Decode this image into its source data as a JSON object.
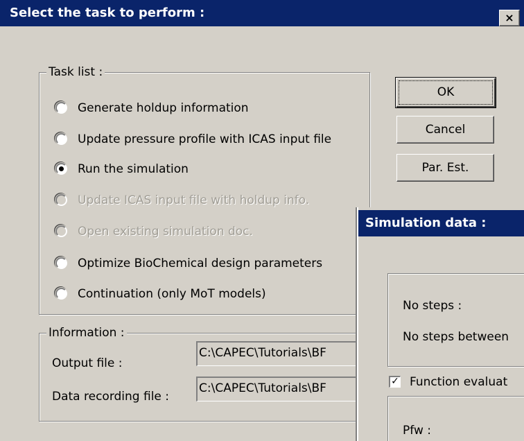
{
  "dialog": {
    "title": "Select the task to perform :",
    "close_glyph": "×"
  },
  "task_list": {
    "title": "Task list :",
    "options": [
      {
        "label": "Generate holdup information",
        "selected": false,
        "enabled": true
      },
      {
        "label": "Update pressure profile with ICAS input file",
        "selected": false,
        "enabled": true
      },
      {
        "label": "Run the simulation",
        "selected": true,
        "enabled": true
      },
      {
        "label": "Update ICAS input file with holdup info.",
        "selected": false,
        "enabled": false
      },
      {
        "label": "Open existing simulation doc.",
        "selected": false,
        "enabled": false
      },
      {
        "label": "Optimize BioChemical design parameters",
        "selected": false,
        "enabled": true
      },
      {
        "label": "Continuation (only MoT models)",
        "selected": false,
        "enabled": true
      }
    ]
  },
  "buttons": {
    "ok": "OK",
    "cancel": "Cancel",
    "par_est": "Par. Est."
  },
  "information": {
    "title": "Information :",
    "output_label": "Output file :",
    "output_value": "C:\\CAPEC\\Tutorials\\BF",
    "data_recording_label": "Data recording file :",
    "data_recording_value": "C:\\CAPEC\\Tutorials\\BF"
  },
  "simulation": {
    "title": "Simulation data :",
    "no_steps_label": "No steps :",
    "no_steps_between_label": "No steps between",
    "function_eval_label": "Function evaluat",
    "function_eval_checked": true,
    "pfw_label": "Pfw :"
  }
}
